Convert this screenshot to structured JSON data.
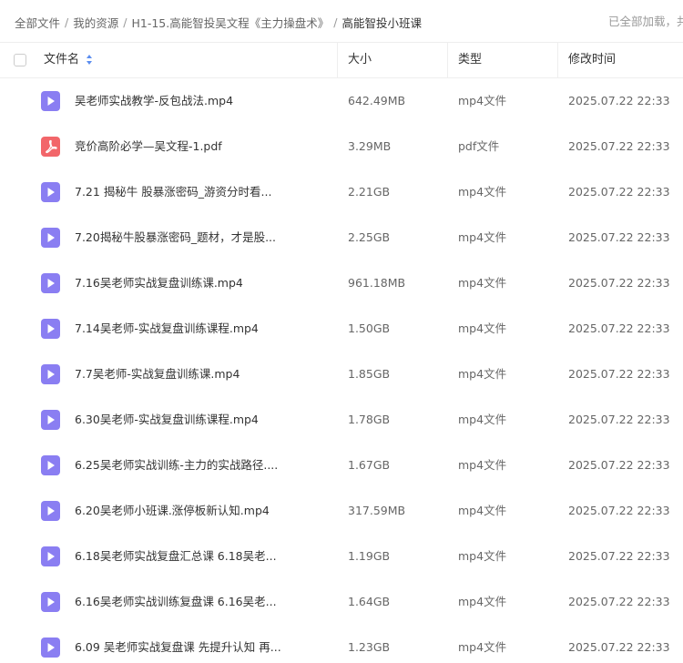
{
  "breadcrumb": {
    "items": [
      "全部文件",
      "我的资源",
      "H1-15.高能智投吴文程《主力操盘术》",
      "高能智投小班课"
    ],
    "separator": "/"
  },
  "load_status": "已全部加载，共",
  "table": {
    "columns": {
      "name": "文件名",
      "size": "大小",
      "type": "类型",
      "modified": "修改时间"
    },
    "rows": [
      {
        "icon": "video-file-icon",
        "name": "吴老师实战教学-反包战法.mp4",
        "size": "642.49MB",
        "type": "mp4文件",
        "modified": "2025.07.22 22:33"
      },
      {
        "icon": "pdf-file-icon",
        "name": "竞价高阶必学—吴文程-1.pdf",
        "size": "3.29MB",
        "type": "pdf文件",
        "modified": "2025.07.22 22:33"
      },
      {
        "icon": "video-file-icon",
        "name": "7.21 揭秘牛 股暴涨密码_游资分时看...",
        "size": "2.21GB",
        "type": "mp4文件",
        "modified": "2025.07.22 22:33"
      },
      {
        "icon": "video-file-icon",
        "name": "7.20揭秘牛股暴涨密码_题材，才是股...",
        "size": "2.25GB",
        "type": "mp4文件",
        "modified": "2025.07.22 22:33"
      },
      {
        "icon": "video-file-icon",
        "name": "7.16吴老师实战复盘训练课.mp4",
        "size": "961.18MB",
        "type": "mp4文件",
        "modified": "2025.07.22 22:33"
      },
      {
        "icon": "video-file-icon",
        "name": "7.14吴老师-实战复盘训练课程.mp4",
        "size": "1.50GB",
        "type": "mp4文件",
        "modified": "2025.07.22 22:33"
      },
      {
        "icon": "video-file-icon",
        "name": "7.7吴老师-实战复盘训练课.mp4",
        "size": "1.85GB",
        "type": "mp4文件",
        "modified": "2025.07.22 22:33"
      },
      {
        "icon": "video-file-icon",
        "name": "6.30吴老师-实战复盘训练课程.mp4",
        "size": "1.78GB",
        "type": "mp4文件",
        "modified": "2025.07.22 22:33"
      },
      {
        "icon": "video-file-icon",
        "name": "6.25吴老师实战训练-主力的实战路径....",
        "size": "1.67GB",
        "type": "mp4文件",
        "modified": "2025.07.22 22:33"
      },
      {
        "icon": "video-file-icon",
        "name": "6.20吴老师小班课.涨停板新认知.mp4",
        "size": "317.59MB",
        "type": "mp4文件",
        "modified": "2025.07.22 22:33"
      },
      {
        "icon": "video-file-icon",
        "name": "6.18吴老师实战复盘汇总课 6.18吴老...",
        "size": "1.19GB",
        "type": "mp4文件",
        "modified": "2025.07.22 22:33"
      },
      {
        "icon": "video-file-icon",
        "name": "6.16吴老师实战训练复盘课 6.16吴老...",
        "size": "1.64GB",
        "type": "mp4文件",
        "modified": "2025.07.22 22:33"
      },
      {
        "icon": "video-file-icon",
        "name": "6.09 吴老师实战复盘课 先提升认知 再...",
        "size": "1.23GB",
        "type": "mp4文件",
        "modified": "2025.07.22 22:33"
      }
    ]
  },
  "colors": {
    "video_icon": "#8a7ef2",
    "pdf_icon": "#f2666a",
    "sort_accent": "#5b8def"
  }
}
